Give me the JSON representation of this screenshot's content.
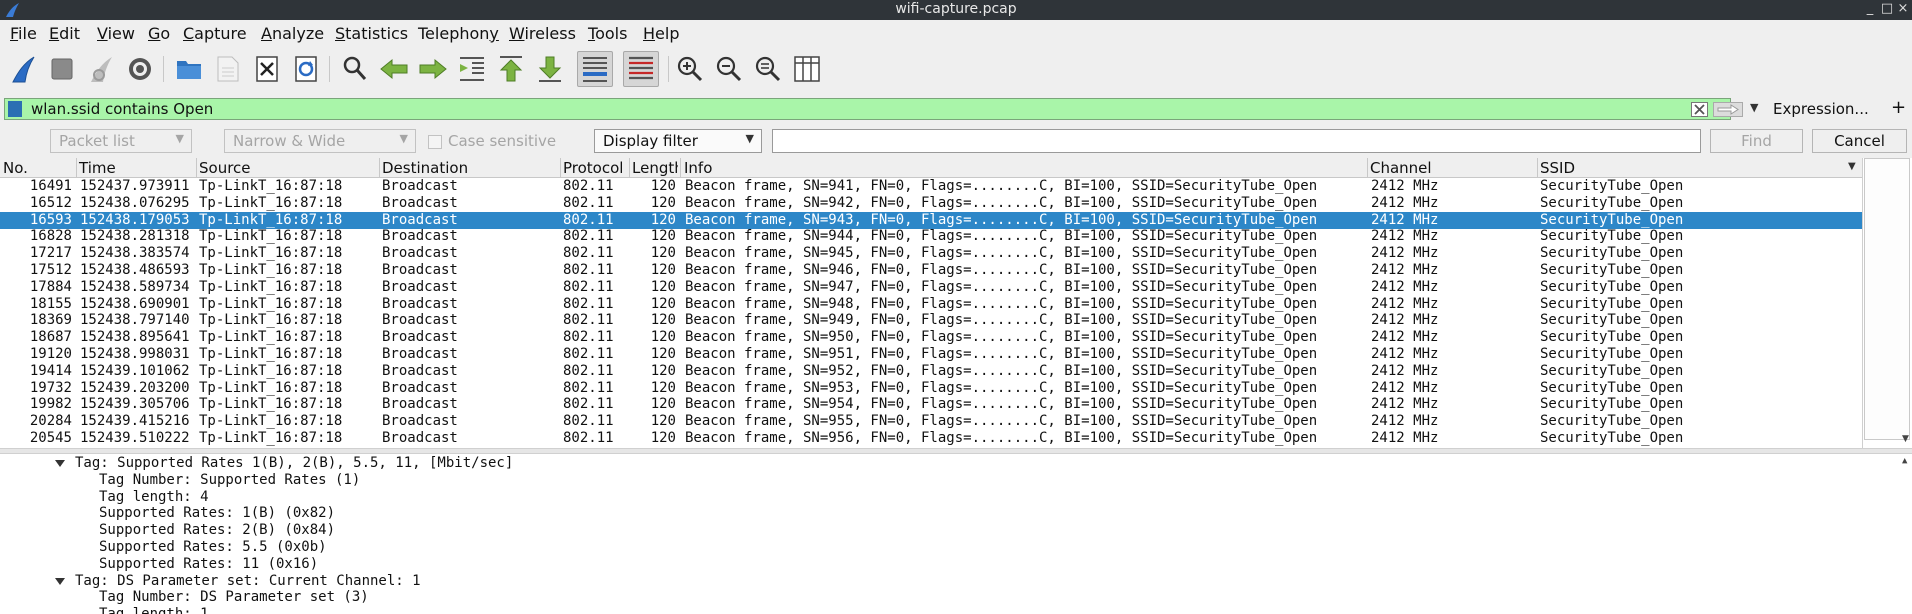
{
  "window": {
    "title": "wifi-capture.pcap",
    "controls": [
      "_",
      "□",
      "×"
    ]
  },
  "menu": [
    {
      "label": "File",
      "u": "F",
      "rest": "ile"
    },
    {
      "label": "Edit",
      "u": "E",
      "rest": "dit"
    },
    {
      "label": "View",
      "u": "V",
      "rest": "iew"
    },
    {
      "label": "Go",
      "u": "G",
      "rest": "o"
    },
    {
      "label": "Capture",
      "u": "C",
      "rest": "apture"
    },
    {
      "label": "Analyze",
      "u": "A",
      "rest": "nalyze"
    },
    {
      "label": "Statistics",
      "u": "S",
      "rest": "tatistics"
    },
    {
      "label": "Telephony",
      "u": "y",
      "pre": "Telephon",
      "rest": ""
    },
    {
      "label": "Wireless",
      "u": "W",
      "rest": "ireless"
    },
    {
      "label": "Tools",
      "u": "T",
      "rest": "ools"
    },
    {
      "label": "Help",
      "u": "H",
      "rest": "elp"
    }
  ],
  "toolbar": {
    "icons": [
      "shark-fin-icon",
      "stop-icon",
      "restart-icon",
      "options-gear-icon",
      "open-folder-icon",
      "save-file-icon",
      "close-file-icon",
      "reload-icon",
      "find-icon",
      "go-back-icon",
      "go-forward-icon",
      "go-to-packet-icon",
      "go-first-icon",
      "go-last-icon",
      "autoscroll-icon",
      "colorize-icon",
      "zoom-in-icon",
      "zoom-out-icon",
      "zoom-normal-icon",
      "resize-columns-icon"
    ]
  },
  "filter": {
    "value": "wlan.ssid contains Open",
    "expression_label": "Expression...",
    "add_label": "+"
  },
  "find": {
    "packet_list": "Packet list",
    "narrow_wide": "Narrow & Wide",
    "case_sensitive": "Case sensitive",
    "search_type": "Display filter",
    "query": "",
    "find_label": "Find",
    "cancel_label": "Cancel"
  },
  "columns": [
    "No.",
    "Time",
    "Source",
    "Destination",
    "Protocol",
    "Length",
    "Info",
    "Channel",
    "SSID"
  ],
  "packets": [
    {
      "no": "16491",
      "time": "152437.973911",
      "src": "Tp-LinkT_16:87:18",
      "dst": "Broadcast",
      "proto": "802.11",
      "len": "120",
      "info": "Beacon frame, SN=941, FN=0, Flags=........C, BI=100, SSID=SecurityTube_Open",
      "chan": "2412 MHz",
      "ssid": "SecurityTube_Open"
    },
    {
      "no": "16512",
      "time": "152438.076295",
      "src": "Tp-LinkT_16:87:18",
      "dst": "Broadcast",
      "proto": "802.11",
      "len": "120",
      "info": "Beacon frame, SN=942, FN=0, Flags=........C, BI=100, SSID=SecurityTube_Open",
      "chan": "2412 MHz",
      "ssid": "SecurityTube_Open"
    },
    {
      "no": "16593",
      "time": "152438.179053",
      "src": "Tp-LinkT_16:87:18",
      "dst": "Broadcast",
      "proto": "802.11",
      "len": "120",
      "info": "Beacon frame, SN=943, FN=0, Flags=........C, BI=100, SSID=SecurityTube_Open",
      "chan": "2412 MHz",
      "ssid": "SecurityTube_Open",
      "selected": true
    },
    {
      "no": "16828",
      "time": "152438.281318",
      "src": "Tp-LinkT_16:87:18",
      "dst": "Broadcast",
      "proto": "802.11",
      "len": "120",
      "info": "Beacon frame, SN=944, FN=0, Flags=........C, BI=100, SSID=SecurityTube_Open",
      "chan": "2412 MHz",
      "ssid": "SecurityTube_Open"
    },
    {
      "no": "17217",
      "time": "152438.383574",
      "src": "Tp-LinkT_16:87:18",
      "dst": "Broadcast",
      "proto": "802.11",
      "len": "120",
      "info": "Beacon frame, SN=945, FN=0, Flags=........C, BI=100, SSID=SecurityTube_Open",
      "chan": "2412 MHz",
      "ssid": "SecurityTube_Open"
    },
    {
      "no": "17512",
      "time": "152438.486593",
      "src": "Tp-LinkT_16:87:18",
      "dst": "Broadcast",
      "proto": "802.11",
      "len": "120",
      "info": "Beacon frame, SN=946, FN=0, Flags=........C, BI=100, SSID=SecurityTube_Open",
      "chan": "2412 MHz",
      "ssid": "SecurityTube_Open"
    },
    {
      "no": "17884",
      "time": "152438.589734",
      "src": "Tp-LinkT_16:87:18",
      "dst": "Broadcast",
      "proto": "802.11",
      "len": "120",
      "info": "Beacon frame, SN=947, FN=0, Flags=........C, BI=100, SSID=SecurityTube_Open",
      "chan": "2412 MHz",
      "ssid": "SecurityTube_Open"
    },
    {
      "no": "18155",
      "time": "152438.690901",
      "src": "Tp-LinkT_16:87:18",
      "dst": "Broadcast",
      "proto": "802.11",
      "len": "120",
      "info": "Beacon frame, SN=948, FN=0, Flags=........C, BI=100, SSID=SecurityTube_Open",
      "chan": "2412 MHz",
      "ssid": "SecurityTube_Open"
    },
    {
      "no": "18369",
      "time": "152438.797140",
      "src": "Tp-LinkT_16:87:18",
      "dst": "Broadcast",
      "proto": "802.11",
      "len": "120",
      "info": "Beacon frame, SN=949, FN=0, Flags=........C, BI=100, SSID=SecurityTube_Open",
      "chan": "2412 MHz",
      "ssid": "SecurityTube_Open"
    },
    {
      "no": "18687",
      "time": "152438.895641",
      "src": "Tp-LinkT_16:87:18",
      "dst": "Broadcast",
      "proto": "802.11",
      "len": "120",
      "info": "Beacon frame, SN=950, FN=0, Flags=........C, BI=100, SSID=SecurityTube_Open",
      "chan": "2412 MHz",
      "ssid": "SecurityTube_Open"
    },
    {
      "no": "19120",
      "time": "152438.998031",
      "src": "Tp-LinkT_16:87:18",
      "dst": "Broadcast",
      "proto": "802.11",
      "len": "120",
      "info": "Beacon frame, SN=951, FN=0, Flags=........C, BI=100, SSID=SecurityTube_Open",
      "chan": "2412 MHz",
      "ssid": "SecurityTube_Open"
    },
    {
      "no": "19414",
      "time": "152439.101062",
      "src": "Tp-LinkT_16:87:18",
      "dst": "Broadcast",
      "proto": "802.11",
      "len": "120",
      "info": "Beacon frame, SN=952, FN=0, Flags=........C, BI=100, SSID=SecurityTube_Open",
      "chan": "2412 MHz",
      "ssid": "SecurityTube_Open"
    },
    {
      "no": "19732",
      "time": "152439.203200",
      "src": "Tp-LinkT_16:87:18",
      "dst": "Broadcast",
      "proto": "802.11",
      "len": "120",
      "info": "Beacon frame, SN=953, FN=0, Flags=........C, BI=100, SSID=SecurityTube_Open",
      "chan": "2412 MHz",
      "ssid": "SecurityTube_Open"
    },
    {
      "no": "19982",
      "time": "152439.305706",
      "src": "Tp-LinkT_16:87:18",
      "dst": "Broadcast",
      "proto": "802.11",
      "len": "120",
      "info": "Beacon frame, SN=954, FN=0, Flags=........C, BI=100, SSID=SecurityTube_Open",
      "chan": "2412 MHz",
      "ssid": "SecurityTube_Open"
    },
    {
      "no": "20284",
      "time": "152439.415216",
      "src": "Tp-LinkT_16:87:18",
      "dst": "Broadcast",
      "proto": "802.11",
      "len": "120",
      "info": "Beacon frame, SN=955, FN=0, Flags=........C, BI=100, SSID=SecurityTube_Open",
      "chan": "2412 MHz",
      "ssid": "SecurityTube_Open"
    },
    {
      "no": "20545",
      "time": "152439.510222",
      "src": "Tp-LinkT_16:87:18",
      "dst": "Broadcast",
      "proto": "802.11",
      "len": "120",
      "info": "Beacon frame, SN=956, FN=0, Flags=........C, BI=100, SSID=SecurityTube_Open",
      "chan": "2412 MHz",
      "ssid": "SecurityTube_Open"
    }
  ],
  "details": [
    {
      "text": "Tag: Supported Rates 1(B), 2(B), 5.5, 11, [Mbit/sec]",
      "level": 0,
      "expanded": true
    },
    {
      "text": "Tag Number: Supported Rates (1)",
      "level": 1
    },
    {
      "text": "Tag length: 4",
      "level": 1
    },
    {
      "text": "Supported Rates: 1(B) (0x82)",
      "level": 1
    },
    {
      "text": "Supported Rates: 2(B) (0x84)",
      "level": 1
    },
    {
      "text": "Supported Rates: 5.5 (0x0b)",
      "level": 1
    },
    {
      "text": "Supported Rates: 11 (0x16)",
      "level": 1
    },
    {
      "text": "Tag: DS Parameter set: Current Channel: 1",
      "level": 0,
      "expanded": true
    },
    {
      "text": "Tag Number: DS Parameter set (3)",
      "level": 1
    },
    {
      "text": "Tag length: 1",
      "level": 1
    }
  ]
}
